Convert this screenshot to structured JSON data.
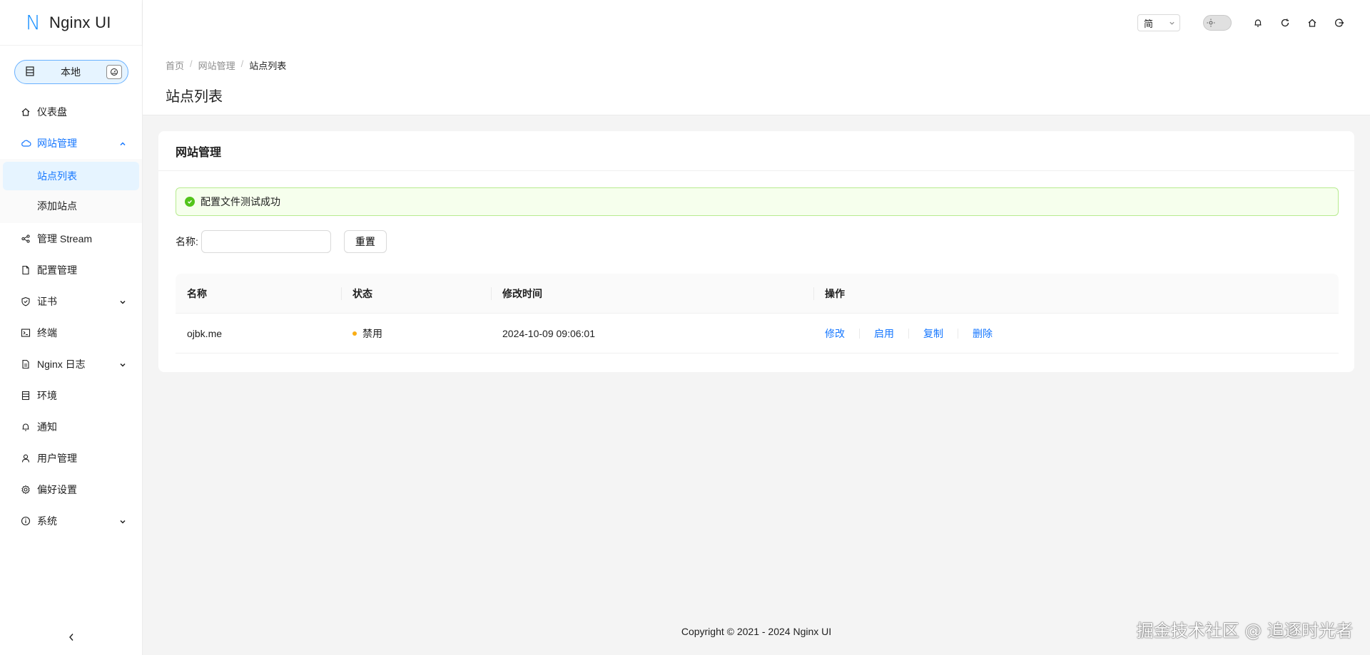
{
  "app": {
    "logo_mark": "N",
    "title": "Nginx UI"
  },
  "env_switch": {
    "label": "本地"
  },
  "sidebar": {
    "items": [
      {
        "label": "仪表盘"
      },
      {
        "label": "网站管理"
      },
      {
        "label": "管理 Stream"
      },
      {
        "label": "配置管理"
      },
      {
        "label": "证书"
      },
      {
        "label": "终端"
      },
      {
        "label": "Nginx 日志"
      },
      {
        "label": "环境"
      },
      {
        "label": "通知"
      },
      {
        "label": "用户管理"
      },
      {
        "label": "偏好设置"
      },
      {
        "label": "系统"
      }
    ],
    "sub_items": [
      {
        "label": "站点列表"
      },
      {
        "label": "添加站点"
      }
    ]
  },
  "header": {
    "lang": "简"
  },
  "breadcrumb": [
    "首页",
    "网站管理",
    "站点列表"
  ],
  "breadcrumb_sep": "/",
  "page_title": "站点列表",
  "card": {
    "title": "网站管理",
    "alert": "配置文件测试成功",
    "filter_label": "名称:",
    "filter_value": "",
    "reset_label": "重置"
  },
  "table": {
    "columns": [
      "名称",
      "状态",
      "修改时间",
      "操作"
    ],
    "rows": [
      {
        "name": "ojbk.me",
        "status": "禁用",
        "modified": "2024-10-09 09:06:01",
        "actions": [
          "修改",
          "启用",
          "复制",
          "删除"
        ]
      }
    ]
  },
  "footer": "Copyright © 2021 - 2024 Nginx UI",
  "watermark": "掘金技术社区 @ 追逐时光者",
  "colors": {
    "accent": "#1677ff",
    "success": "#52c41a",
    "warning": "#faad14"
  }
}
